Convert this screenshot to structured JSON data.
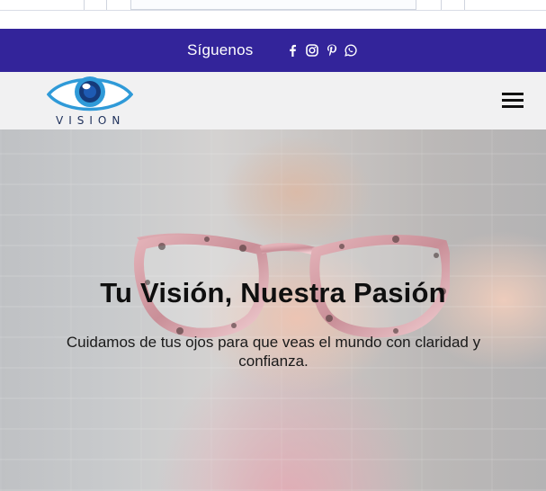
{
  "social_bar": {
    "label": "Síguenos",
    "icons": [
      "facebook-icon",
      "instagram-icon",
      "pinterest-icon",
      "whatsapp-icon"
    ],
    "background": "#33249a"
  },
  "header": {
    "logo_text": "VISION",
    "menu_icon": "hamburger-menu-icon"
  },
  "hero": {
    "title": "Tu Visión, Nuestra Pasión",
    "subtitle": "Cuidamos de tus ojos para que veas el mundo con claridad y confianza."
  }
}
